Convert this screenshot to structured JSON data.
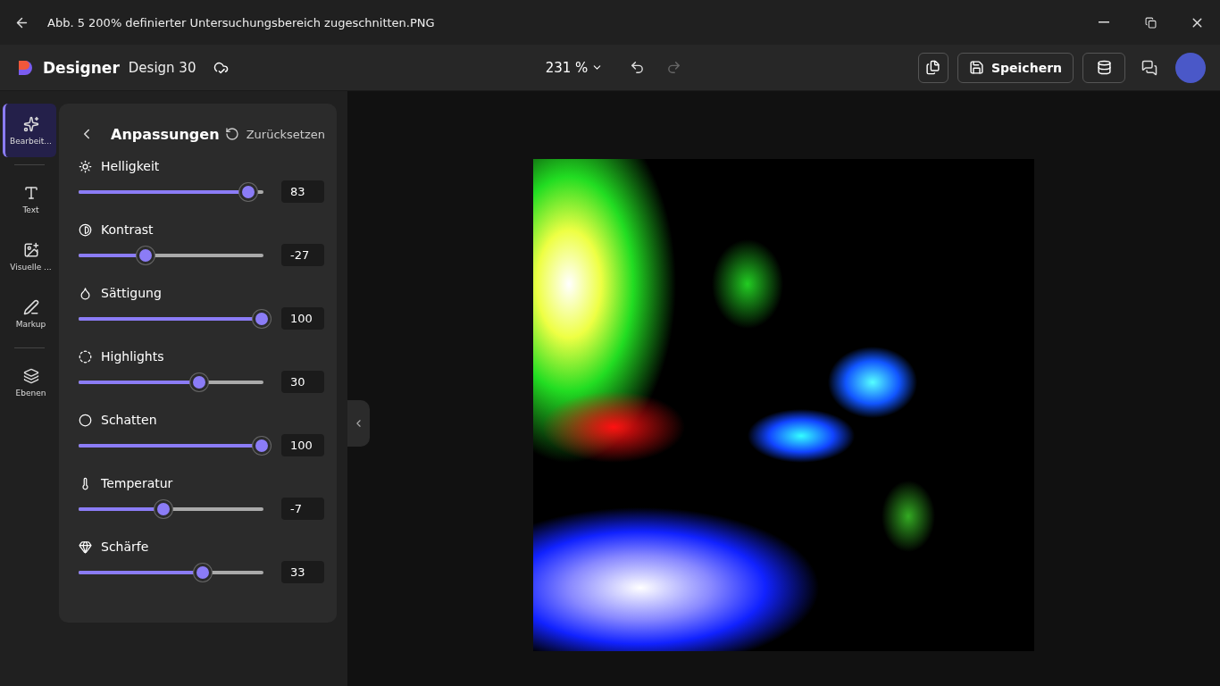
{
  "window": {
    "title": "Abb. 5 200% definierter Untersuchungsbereich zugeschnitten.PNG"
  },
  "app_bar": {
    "app_name": "Designer",
    "document": "Design 30",
    "zoom": "231 %",
    "save": "Speichern"
  },
  "rail": [
    {
      "label": "Bearbeit...",
      "selected": true
    },
    {
      "label": "Text",
      "selected": false
    },
    {
      "label": "Visuelle ...",
      "selected": false
    },
    {
      "label": "Markup",
      "selected": false
    },
    {
      "label": "Ebenen",
      "selected": false
    }
  ],
  "panel": {
    "title": "Anpassungen",
    "reset": "Zurücksetzen",
    "adjustments": [
      {
        "label": "Helligkeit",
        "level": 0.92,
        "value": "83"
      },
      {
        "label": "Kontrast",
        "level": 0.36,
        "value": "-27"
      },
      {
        "label": "Sättigung",
        "level": 1,
        "value": "100"
      },
      {
        "label": "Highlights",
        "level": 0.65,
        "value": "30"
      },
      {
        "label": "Schatten",
        "level": 1,
        "value": "100"
      },
      {
        "label": "Temperatur",
        "level": 0.46,
        "value": "-7"
      },
      {
        "label": "Schärfe",
        "level": 0.67,
        "value": "33"
      }
    ]
  }
}
